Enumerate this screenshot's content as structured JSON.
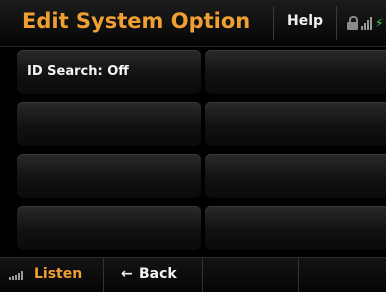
{
  "header": {
    "title": "Edit System Option",
    "help_label": "Help",
    "status_icons": [
      "lock-icon",
      "signal-icon",
      "charging-icon"
    ],
    "status_bolt_glyph": "⚡"
  },
  "options": [
    {
      "label": "ID Search: Off"
    },
    {
      "label": ""
    },
    {
      "label": ""
    },
    {
      "label": ""
    },
    {
      "label": ""
    },
    {
      "label": ""
    },
    {
      "label": ""
    },
    {
      "label": ""
    }
  ],
  "footer": {
    "listen_label": "Listen",
    "back_arrow": "←",
    "back_label": "Back"
  },
  "colors": {
    "accent": "#f0a030",
    "text": "#f2f2f2",
    "background": "#000000",
    "charging": "#3ad43a"
  }
}
